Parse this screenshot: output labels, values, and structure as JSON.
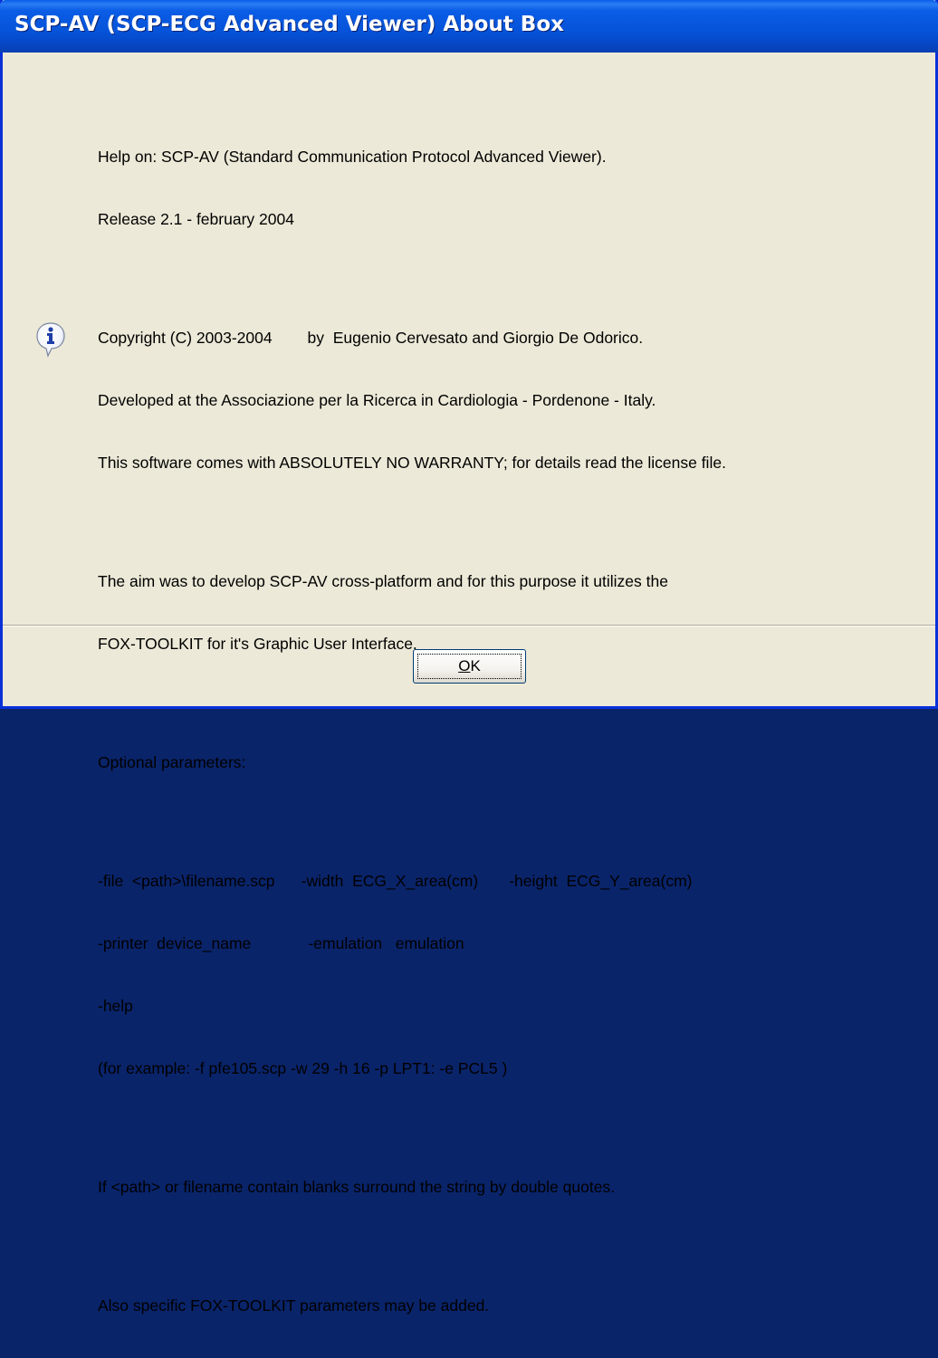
{
  "window": {
    "title": "SCP-AV (SCP-ECG Advanced Viewer) About Box"
  },
  "message": {
    "lines": [
      "Help on: SCP-AV (Standard Communication Protocol Advanced Viewer).",
      "Release 2.1 - february 2004",
      "",
      "Copyright (C) 2003-2004        by  Eugenio Cervesato and Giorgio De Odorico.",
      "Developed at the Associazione per la Ricerca in Cardiologia - Pordenone - Italy.",
      "This software comes with ABSOLUTELY NO WARRANTY; for details read the license file.",
      "",
      "The aim was to develop SCP-AV cross-platform and for this purpose it utilizes the",
      "FOX-TOOLKIT for it's Graphic User Interface.",
      "",
      "Optional parameters:",
      "",
      "-file  <path>\\filename.scp      -width  ECG_X_area(cm)       -height  ECG_Y_area(cm)",
      "-printer  device_name             -emulation   emulation",
      "-help",
      "(for example: -f pfe105.scp -w 29 -h 16 -p LPT1: -e PCL5 )",
      "",
      "If <path> or filename contain blanks surround the string by double quotes.",
      "",
      "Also specific FOX-TOOLKIT parameters may be added."
    ]
  },
  "icon": "info-icon",
  "buttons": {
    "ok_label": "OK",
    "ok_mnemonic": "O",
    "ok_rest": "K"
  },
  "colors": {
    "title_bar": "#0553d9",
    "dialog_background": "#ece9d8",
    "frame_border": "#0831d9"
  }
}
